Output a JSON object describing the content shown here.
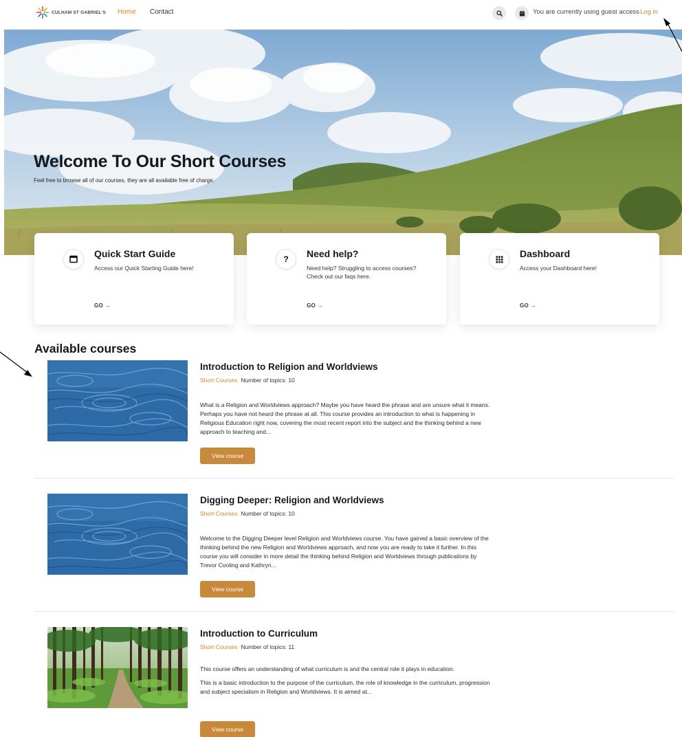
{
  "brand": {
    "name": "CULHAM ST GABRIEL'S"
  },
  "nav": {
    "home": "Home",
    "contact": "Contact",
    "guest_text": "You are currently using guest access",
    "login": "Log in"
  },
  "hero": {
    "title": "Welcome To Our Short Courses",
    "subtitle": "Feel free to browse all of our courses, they are all available free of charge."
  },
  "cards": [
    {
      "title": "Quick Start Guide",
      "desc": "Access our Quick Starting Guide here!",
      "go": "GO →",
      "icon": "window-icon"
    },
    {
      "title": "Need help?",
      "desc": "Need help? Struggling to access courses? Check out our faqs here.",
      "go": "GO →",
      "icon": "question-icon"
    },
    {
      "title": "Dashboard",
      "desc": "Access your Dashboard here!",
      "go": "GO →",
      "icon": "grid-icon"
    }
  ],
  "courses_section": {
    "title": "Available courses"
  },
  "courses": [
    {
      "title": "Introduction to Religion and Worldviews",
      "category": "Short Courses",
      "topics": "Number of topics: 10",
      "summary": [
        "What is a Religion and Worldviews approach? Maybe you have heard the phrase and are unsure what it means. Perhaps you have not heard the phrase at all. This course provides an introduction to what is happening in Religious Education right now, covering the most recent report into the subject and the thinking behind a new approach to teaching and..."
      ],
      "button": "View course",
      "image": "water-ripple-image"
    },
    {
      "title": "Digging Deeper: Religion and Worldviews",
      "category": "Short Courses",
      "topics": "Number of topics: 10",
      "summary": [
        "Welcome to the Digging Deeper level Religion and Worldviews course. You have gained a basic overview of the thinking behind the new Religion and Worldviews approach, and now you are ready to take it further. In this course you will consider in more detail the thinking behind Religion and Worldviews through publications by Trevor Cooling and Kathryn..."
      ],
      "button": "View course",
      "image": "water-ripple-image"
    },
    {
      "title": "Introduction to Curriculum",
      "category": "Short Courses",
      "topics": "Number of topics: 11",
      "summary": [
        "This course offers an understanding of what curriculum is and the central role it plays in education.",
        "This is a basic introduction to the purpose of the curriculum, the role of knowledge in the curriculum, progression and subject specialism in Religion and Worldviews. It is aimed at..."
      ],
      "button": "View course",
      "image": "forest-path-image"
    }
  ],
  "colors": {
    "accent": "#d08a1f",
    "button": "#c9893a"
  }
}
